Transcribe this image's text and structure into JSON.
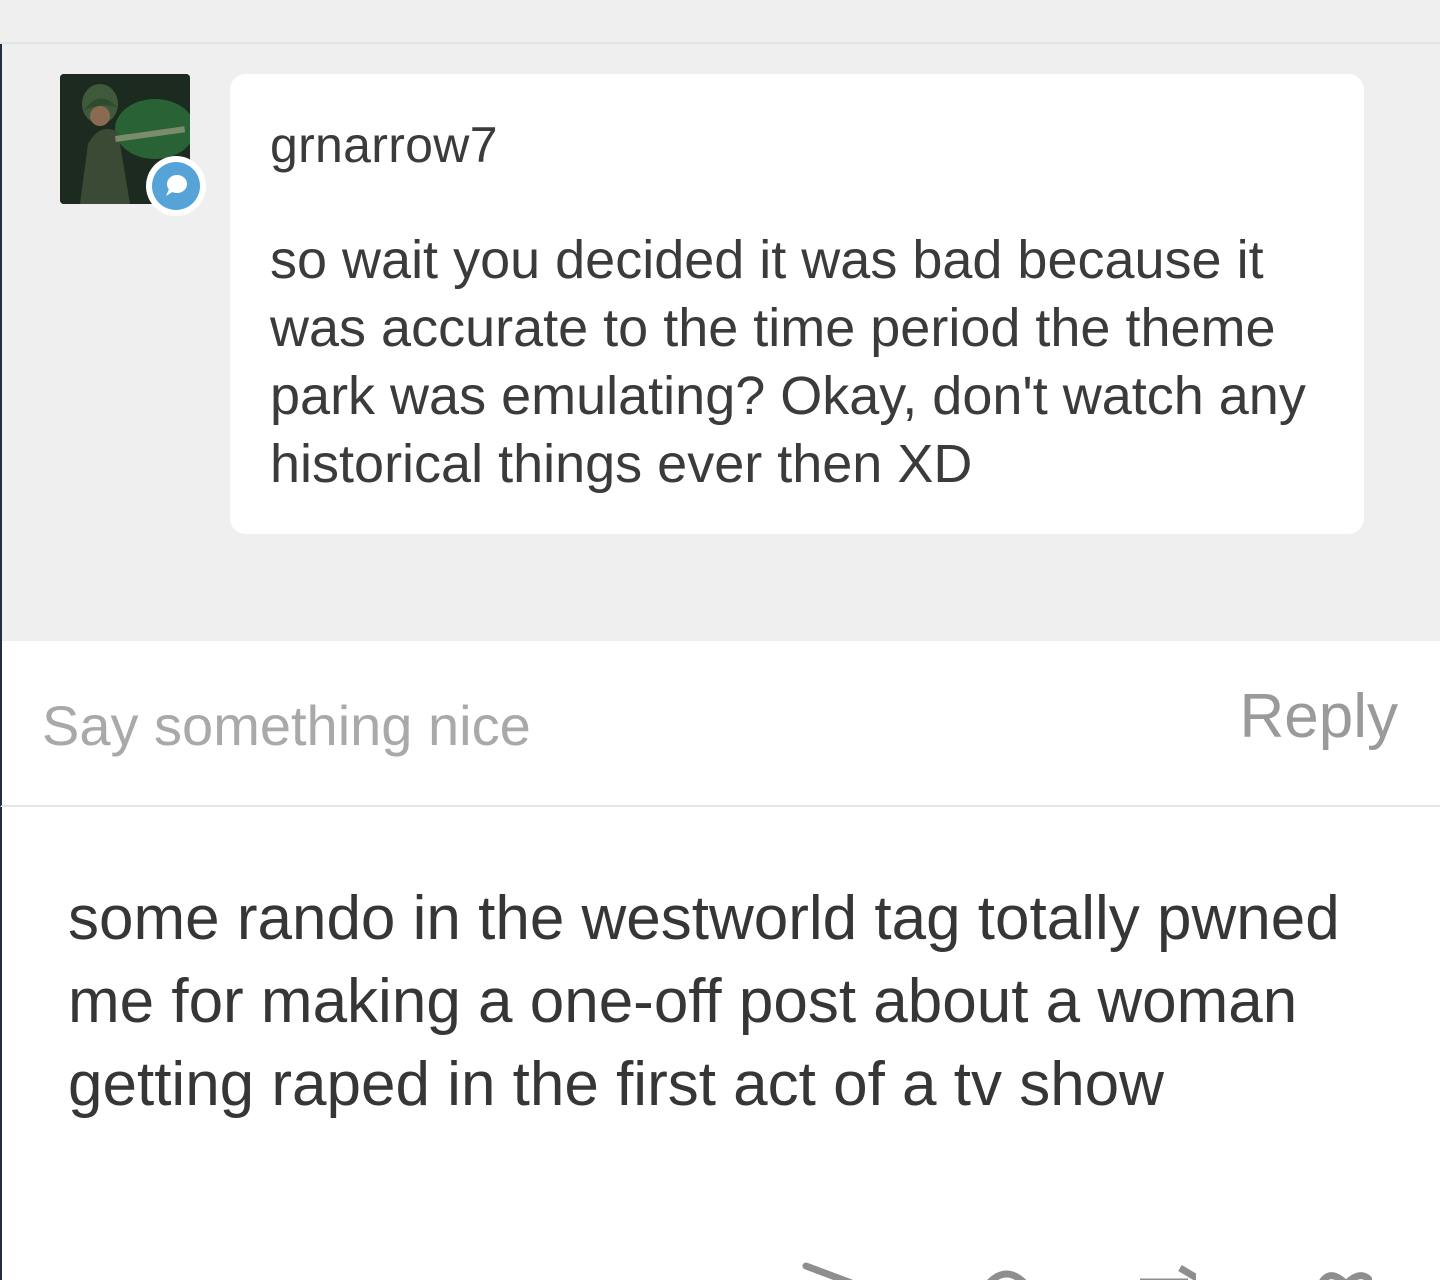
{
  "comment": {
    "username": "grnarrow7",
    "text": "so wait you decided it was bad because it was accurate to the time period the theme park was emulating? Okay, don't watch any historical things ever then XD",
    "avatar_icon": "user-avatar",
    "badge_icon": "speech-bubble-icon",
    "badge_color": "#56a3d8"
  },
  "reply_bar": {
    "placeholder": "Say something nice",
    "reply_label": "Reply"
  },
  "post": {
    "text": "some rando in the westworld tag totally pwned me for making a one-off post about a woman getting raped in the first act of a tv show"
  },
  "actions": {
    "icons": [
      "share-icon",
      "comment-icon",
      "reblog-icon",
      "like-icon"
    ]
  },
  "colors": {
    "background_gray": "#efefef",
    "text_dark": "#3b3b3b",
    "placeholder_gray": "#a9a9a9",
    "reply_gray": "#9a9a9a"
  }
}
